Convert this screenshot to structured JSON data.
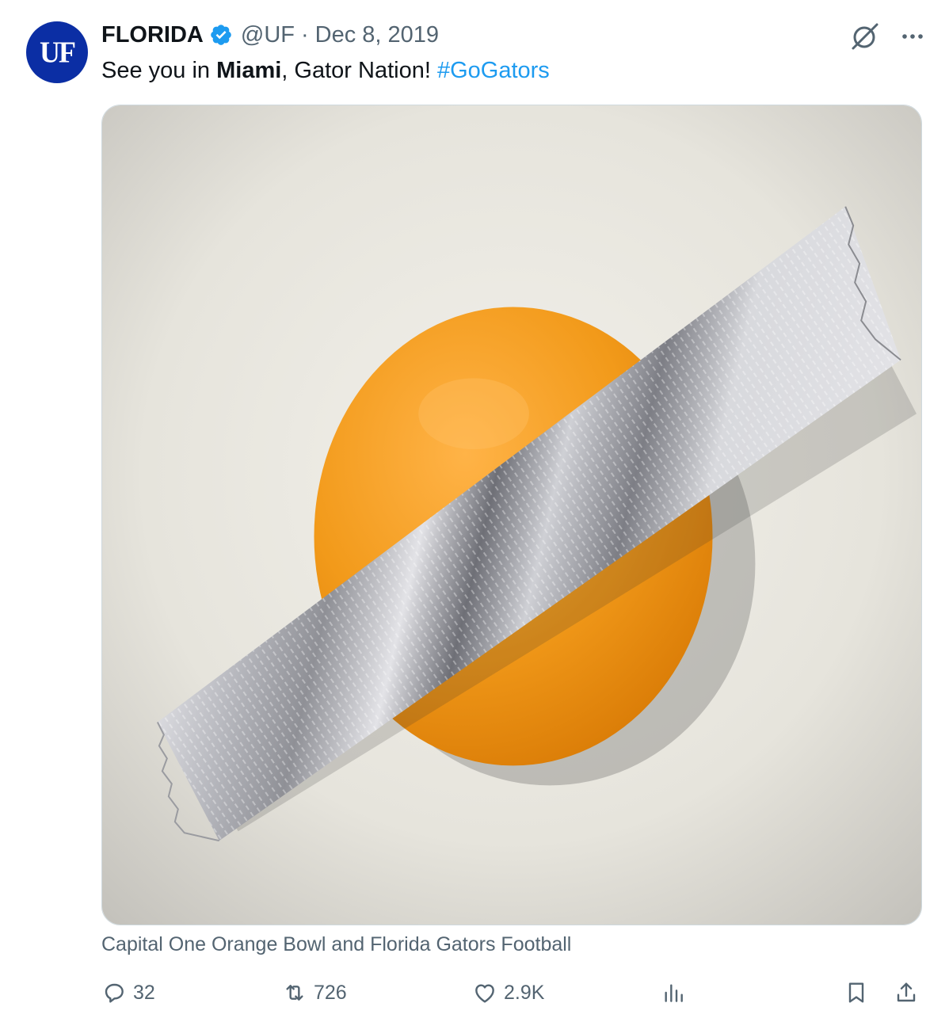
{
  "account": {
    "avatar_text": "UF",
    "name": "FLORIDA",
    "handle": "@UF",
    "separator": "·",
    "date": "Dec 8, 2019"
  },
  "tweet": {
    "text_part1": "See you in ",
    "text_bold": "Miami",
    "text_part2": ", Gator Nation! ",
    "hashtag": "#GoGators"
  },
  "media": {
    "description_icon": "orange-with-duct-tape-image",
    "caption": "Capital One Orange Bowl and Florida Gators Football"
  },
  "actions": {
    "reply_count": "32",
    "retweet_count": "726",
    "like_count": "2.9K"
  },
  "icons": {
    "verified": "verified-badge-icon",
    "grok": "grok-icon",
    "more": "more-icon",
    "reply": "reply-icon",
    "retweet": "retweet-icon",
    "like": "heart-icon",
    "views": "views-icon",
    "bookmark": "bookmark-icon",
    "share": "share-icon"
  },
  "colors": {
    "accent": "#1d9bf0",
    "secondary_text": "#536471",
    "avatar_bg": "#0b2ea4",
    "orange": "#f29a1a"
  }
}
